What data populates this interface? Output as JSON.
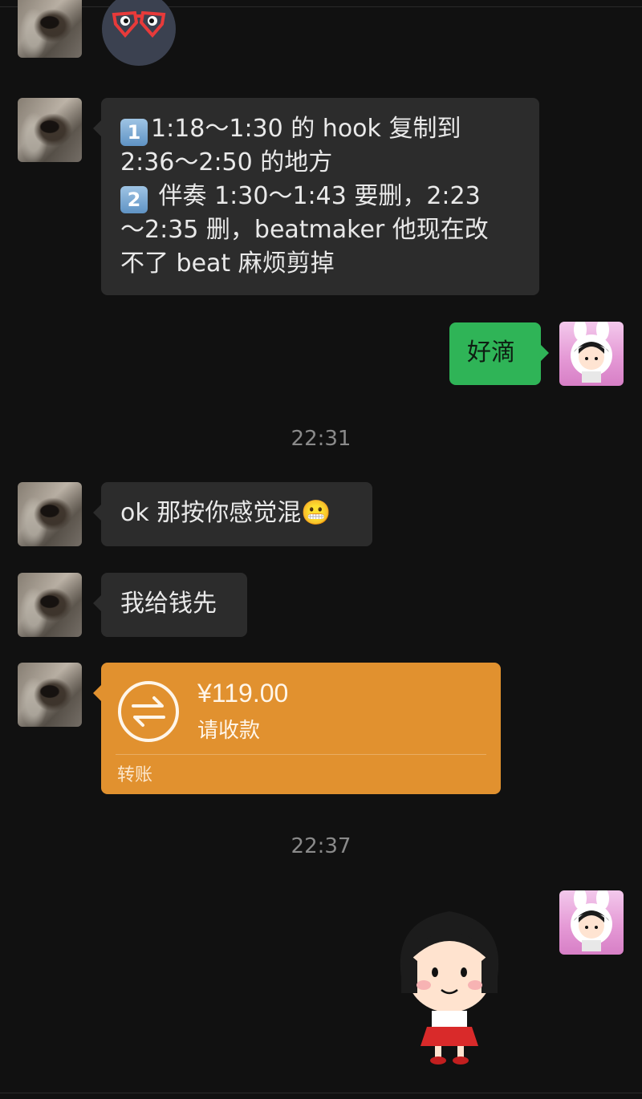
{
  "messages": {
    "m1": {
      "key1": "1",
      "line1a": "1:18～1:30 的 hook 复制到",
      "line1b": "2:36～2:50 的地方",
      "key2": "2",
      "line2a": " 伴奏 1:30～1:43 要删，2:23",
      "line2b": "～2:35 删，beatmaker 他现在改",
      "line2c": "不了 beat 麻烦剪掉"
    },
    "m2": "好滴",
    "time1": "22:31",
    "m3": "ok 那按你感觉混😬",
    "m4": "我给钱先",
    "transfer": {
      "amount": "¥119.00",
      "status": "请收款",
      "label": "转账"
    },
    "time2": "22:37"
  },
  "colors": {
    "background": "#111111",
    "incoming_bubble": "#2c2c2c",
    "outgoing_bubble": "#2fb457",
    "transfer_card": "#e1912f"
  },
  "icons": {
    "transfer": "transfer-arrows-icon",
    "sticker_top": "sunglasses-emoji-sticker",
    "sticker_bottom": "maruko-girl-sticker"
  }
}
